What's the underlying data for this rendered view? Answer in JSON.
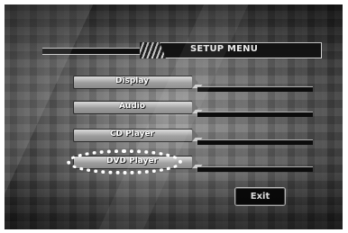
{
  "menu": {
    "title": "SETUP MENU",
    "items": [
      {
        "label": "Display"
      },
      {
        "label": "Audio"
      },
      {
        "label": "CD Player"
      },
      {
        "label": "DVD Player"
      }
    ],
    "highlighted_item": "DVD Player",
    "exit_label": "Exit"
  }
}
